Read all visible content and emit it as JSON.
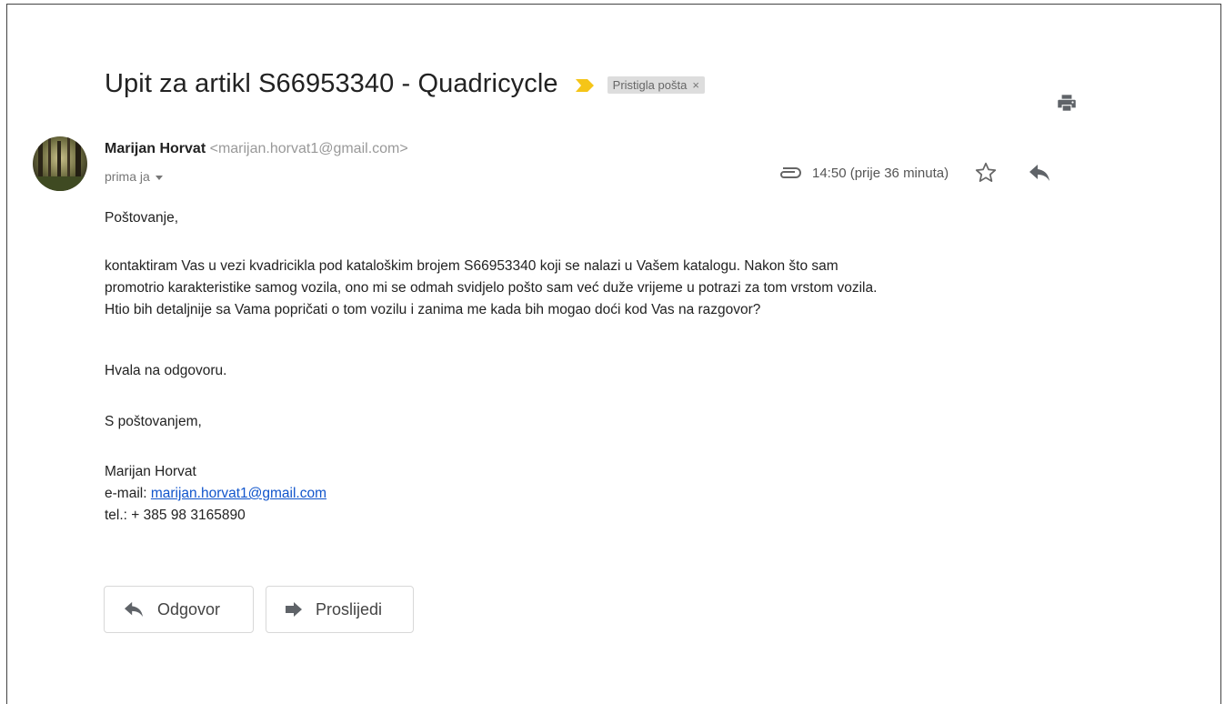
{
  "email": {
    "subject": "Upit za artikl S66953340 - Quadricycle",
    "label": "Pristigla pošta",
    "label_close": "×",
    "importance_color": "#f5c518",
    "sender_name": "Marijan Horvat",
    "sender_email": "<marijan.horvat1@gmail.com>",
    "recipient": "prima ja",
    "time": "14:50 (prije 36 minuta)",
    "icons": {
      "print": "print-icon",
      "attachment": "attachment-icon",
      "star": "star-icon",
      "reply": "reply-icon",
      "forward": "forward-icon",
      "importance": "importance-marker-icon"
    }
  },
  "body": {
    "greeting": "Poštovanje,",
    "paragraph_lines": [
      "kontaktiram Vas u vezi kvadricikla pod kataloškim brojem S66953340 koji se nalazi u Vašem katalogu. Nakon što sam",
      "promotrio karakteristike samog vozila, ono mi se odmah svidjelo pošto sam već duže vrijeme u potrazi za tom vrstom vozila.",
      "Htio bih detaljnije sa Vama popričati o tom vozilu i zanima me kada bih mogao doći kod Vas na razgovor?"
    ],
    "thanks": "Hvala na odgovoru.",
    "closing": "S poštovanjem,",
    "signature": {
      "name": "Marijan Horvat",
      "email_prefix": "e-mail: ",
      "email_link": "marijan.horvat1@gmail.com",
      "phone": "tel.: + 385 98 3165890"
    }
  },
  "actions": {
    "reply_label": "Odgovor",
    "forward_label": "Proslijedi"
  },
  "colors": {
    "link": "#1155cc",
    "label_bg": "#dddddd"
  }
}
